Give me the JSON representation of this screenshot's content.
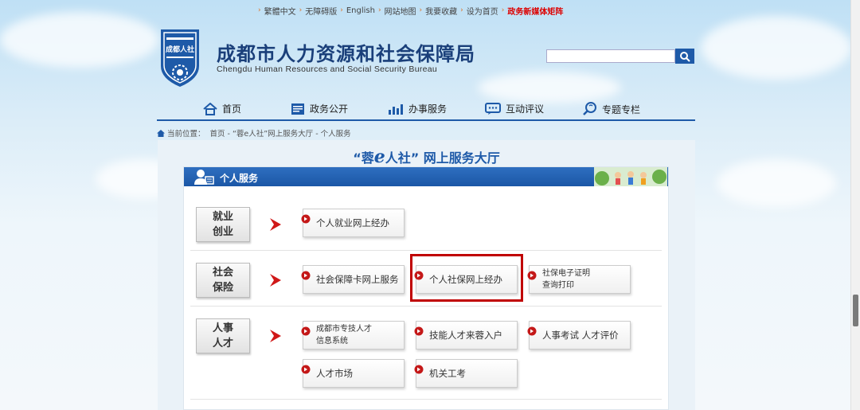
{
  "topbar": {
    "items": [
      "繁體中文",
      "无障碍版",
      "English",
      "网站地图",
      "我要收藏",
      "设为首页",
      "政务新媒体矩阵"
    ]
  },
  "header": {
    "title": "成都市人力资源和社会保障局",
    "subtitle": "Chengdu Human Resources and Social Security Bureau",
    "logo_text": "成都人社",
    "search_placeholder": ""
  },
  "nav": {
    "items": [
      "首页",
      "政务公开",
      "办事服务",
      "互动评议",
      "专题专栏"
    ]
  },
  "breadcrumb": {
    "prefix": "当前位置：",
    "path": "首页 - “蓉e人社”网上服务大厅 - 个人服务"
  },
  "hall": {
    "title_left": "“蓉",
    "title_e": "e",
    "title_right": "人社” 网上服务大厅"
  },
  "section": {
    "title": "个人服务"
  },
  "rows": [
    {
      "label_line1": "就业",
      "label_line2": "创业",
      "services": [
        "个人就业网上经办"
      ]
    },
    {
      "label_line1": "社会",
      "label_line2": "保险",
      "services": [
        "社会保障卡网上服务",
        "个人社保网上经办",
        "社保电子证明",
        "查询打印"
      ]
    },
    {
      "label_line1": "人事",
      "label_line2": "人才",
      "services": [
        "成都市专技人才",
        "信息系统",
        "技能人才来蓉入户",
        "人事考试 人才评价",
        "人才市场",
        "机关工考"
      ]
    }
  ],
  "colors": {
    "brand_blue": "#1e5aa8",
    "highlight_red": "#c00000",
    "arrow_red": "#d01818"
  }
}
